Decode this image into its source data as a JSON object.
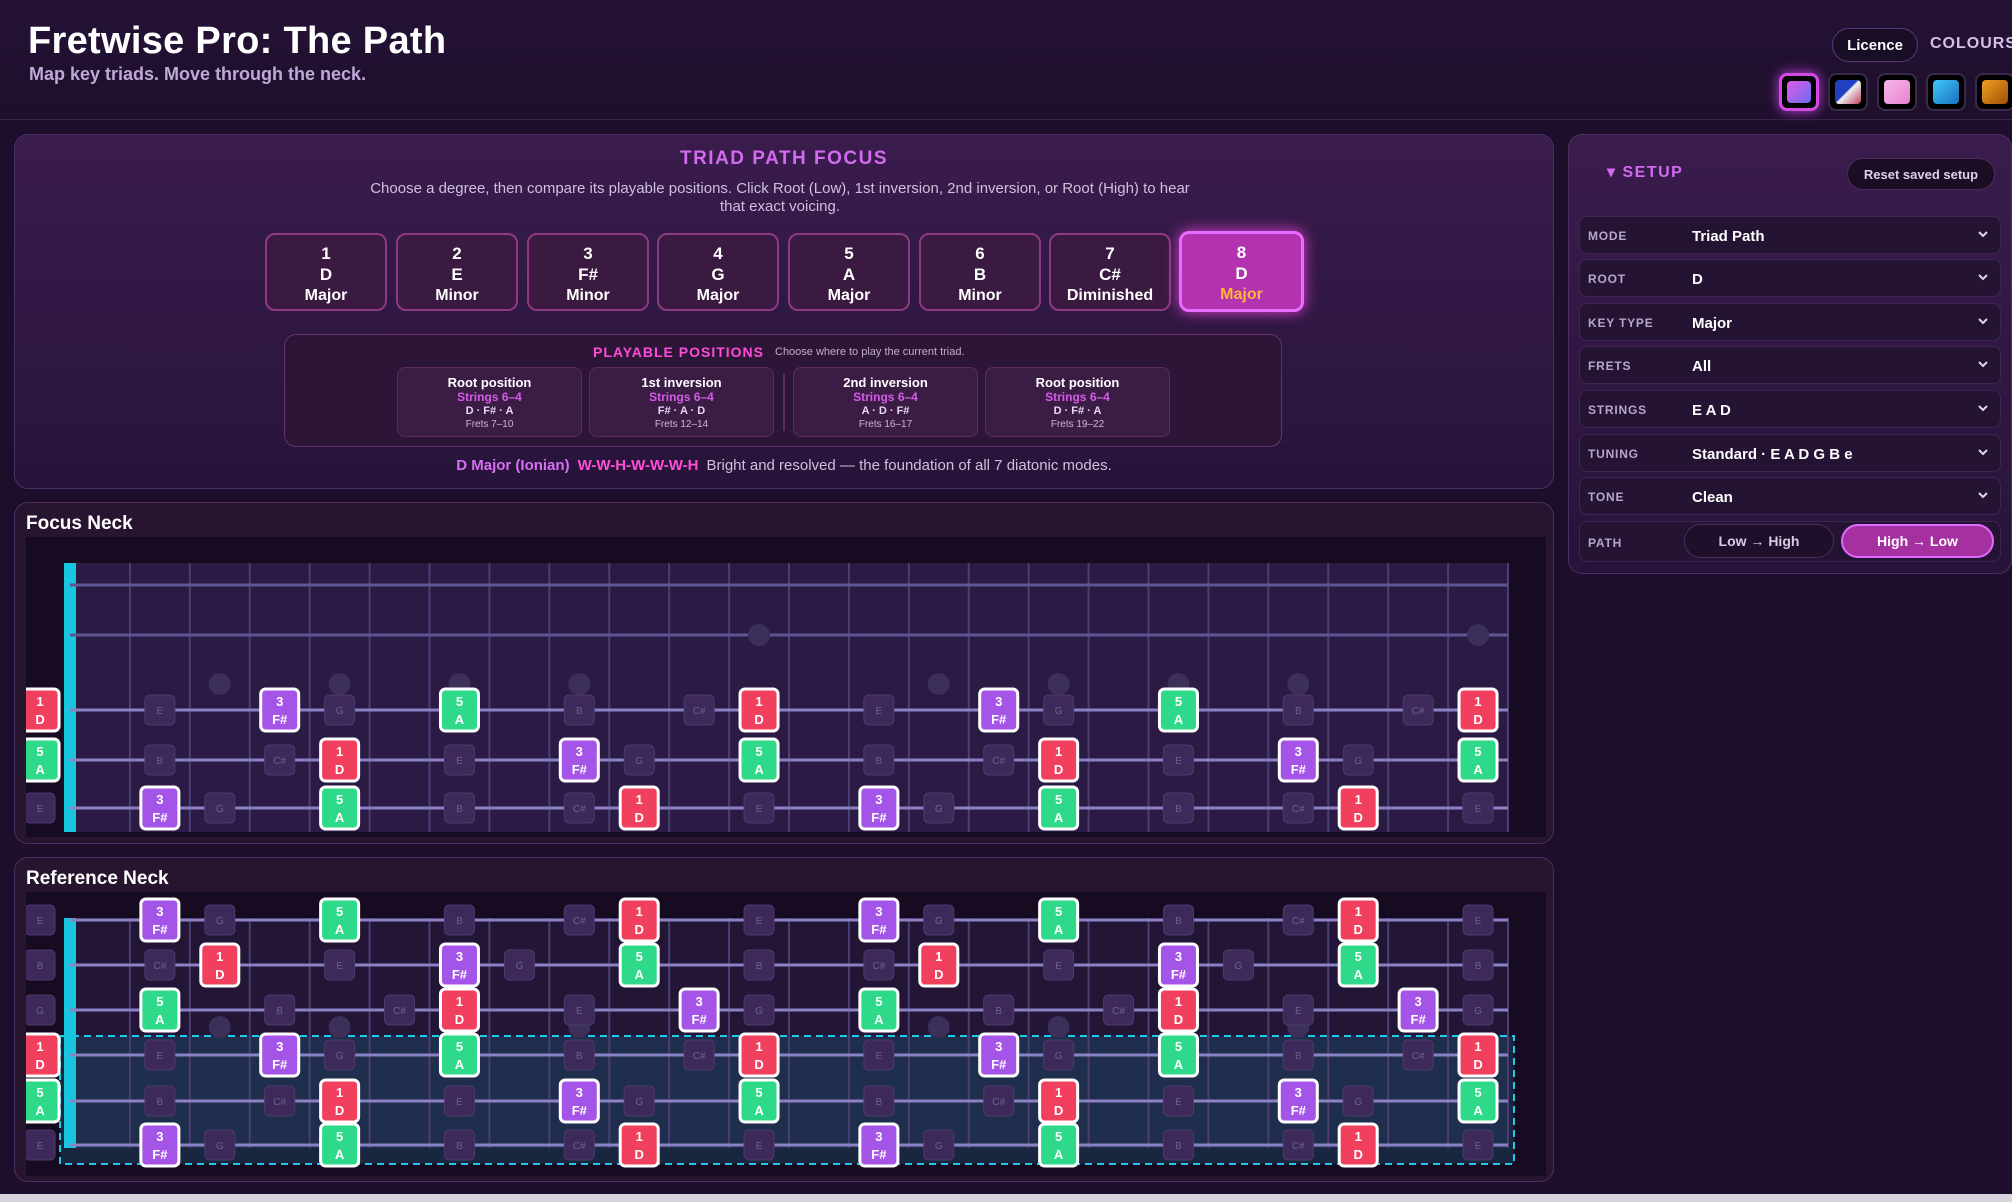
{
  "header": {
    "title": "Fretwise Pro: The Path",
    "subtitle": "Map key triads. Move through the neck.",
    "licence_label": "Licence",
    "colours_label": "COLOURS",
    "swatch_colors": [
      "#c848e8",
      "#3050d0",
      "#f0a0e0",
      "#2ab8f0",
      "#e08a10"
    ]
  },
  "focus": {
    "title": "TRIAD PATH FOCUS",
    "description": "Choose a degree, then compare its playable positions. Click Root (Low), 1st inversion, 2nd inversion, or Root (High) to hear that exact voicing.",
    "degrees": [
      {
        "num": "1",
        "note": "D",
        "quality": "Major"
      },
      {
        "num": "2",
        "note": "E",
        "quality": "Minor"
      },
      {
        "num": "3",
        "note": "F#",
        "quality": "Minor"
      },
      {
        "num": "4",
        "note": "G",
        "quality": "Major"
      },
      {
        "num": "5",
        "note": "A",
        "quality": "Major"
      },
      {
        "num": "6",
        "note": "B",
        "quality": "Minor"
      },
      {
        "num": "7",
        "note": "C#",
        "quality": "Diminished"
      },
      {
        "num": "8",
        "note": "D",
        "quality": "Major"
      }
    ],
    "selected_degree": 8,
    "positions_title": "PLAYABLE POSITIONS",
    "positions_hint": "Choose where to play the current triad.",
    "positions": [
      {
        "name": "Root position",
        "strings": "Strings 6–4",
        "notes": "D · F# · A",
        "frets": "Frets 7–10"
      },
      {
        "name": "1st inversion",
        "strings": "Strings 6–4",
        "notes": "F# · A · D",
        "frets": "Frets 12–14"
      },
      {
        "name": "2nd inversion",
        "strings": "Strings 6–4",
        "notes": "A · D · F#",
        "frets": "Frets 16–17"
      },
      {
        "name": "Root position",
        "strings": "Strings 6–4",
        "notes": "D · F# · A",
        "frets": "Frets 19–22"
      }
    ],
    "mode_name": "D Major (Ionian)",
    "mode_pattern": "W-W-H-W-W-W-H",
    "mode_desc": "Bright and resolved — the foundation of all 7 diatonic modes."
  },
  "necks": {
    "focus_title": "Focus Neck",
    "reference_title": "Reference Neck",
    "colors": {
      "root": "#f0405e",
      "third": "#a455e8",
      "fifth": "#2fd98a",
      "ghost": "#3d2a5a",
      "nut": "#19c6e0"
    },
    "fret_count": 24,
    "tuning_low_to_high": [
      "E",
      "A",
      "D",
      "G",
      "B",
      "E"
    ],
    "visible_strings_focus": [
      1,
      2,
      3
    ],
    "triad": [
      {
        "note": "D",
        "degree": "1",
        "role": "root"
      },
      {
        "note": "F#",
        "degree": "3",
        "role": "third"
      },
      {
        "note": "A",
        "degree": "5",
        "role": "fifth"
      }
    ],
    "scale_notes": [
      "D",
      "E",
      "F#",
      "G",
      "A",
      "B",
      "C#"
    ]
  },
  "setup": {
    "title": "SETUP",
    "reset_label": "Reset saved setup",
    "rows": [
      {
        "label": "MODE",
        "value": "Triad Path"
      },
      {
        "label": "ROOT",
        "value": "D"
      },
      {
        "label": "KEY TYPE",
        "value": "Major"
      },
      {
        "label": "FRETS",
        "value": "All"
      },
      {
        "label": "STRINGS",
        "value": "E A D"
      },
      {
        "label": "TUNING",
        "value": "Standard · E A D G B e"
      },
      {
        "label": "TONE",
        "value": "Clean"
      }
    ],
    "path_label": "PATH",
    "path_options": [
      "Low → High",
      "High → Low"
    ],
    "path_selected": "High → Low"
  }
}
